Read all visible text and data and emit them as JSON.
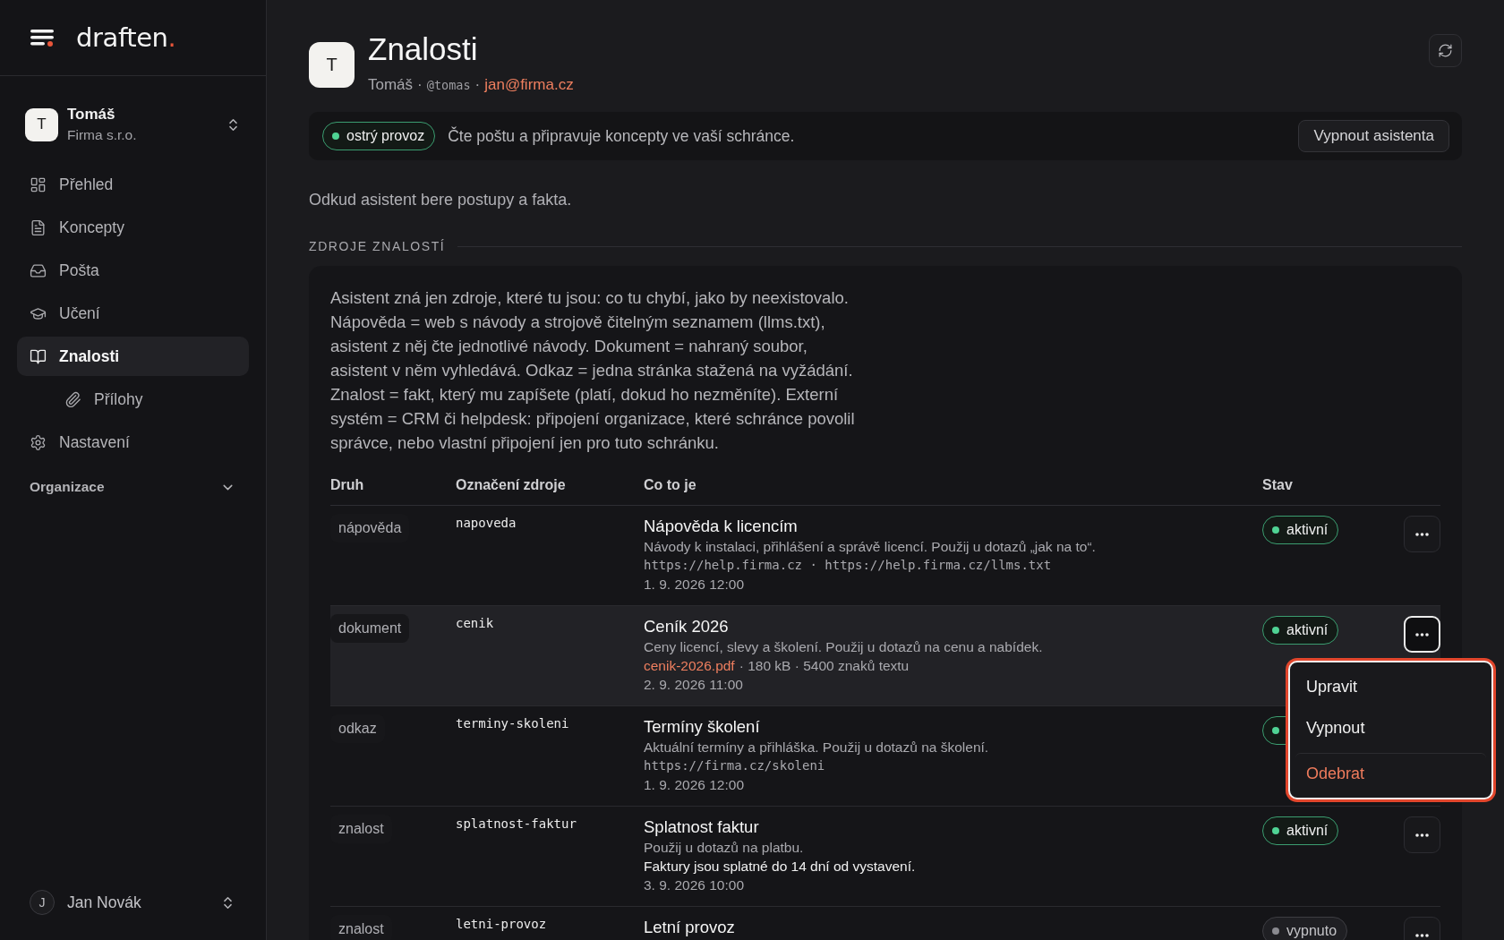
{
  "sidebar": {
    "logo": {
      "name": "draften",
      "dot": "."
    },
    "workspace": {
      "initial": "T",
      "name": "Tomáš",
      "org": "Firma s.r.o."
    },
    "nav": [
      {
        "label": "Přehled",
        "selected": false
      },
      {
        "label": "Koncepty",
        "selected": false
      },
      {
        "label": "Pošta",
        "selected": false
      },
      {
        "label": "Učení",
        "selected": false
      },
      {
        "label": "Znalosti",
        "selected": true,
        "children": [
          {
            "label": "Přílohy",
            "selected": false
          }
        ]
      },
      {
        "label": "Nastavení",
        "selected": false
      }
    ],
    "sections": [
      {
        "label": "Organizace",
        "expanded": false
      }
    ],
    "user": {
      "initial": "J",
      "name": "Jan Novák"
    }
  },
  "header": {
    "initial": "T",
    "title": "Znalosti",
    "owner": "Tomáš",
    "separator": "·",
    "handle": "@tomas",
    "email": "jan@firma.cz"
  },
  "status_bar": {
    "badge": {
      "label": "ostrý provoz",
      "live": true
    },
    "text": "Čte poštu a připravuje koncepty ve vaší schránce.",
    "button": "Vypnout asistenta"
  },
  "intro": "Odkud asistent bere postupy a fakta.",
  "sources": {
    "title": "ZDROJE ZNALOSTÍ",
    "description": "Asistent zná jen zdroje, které tu jsou: co tu chybí, jako by neexistovalo. Nápověda = web s návody a strojově čitelným seznamem (llms.txt), asistent z něj čte jednotlivé návody. Dokument = nahraný soubor, asistent v něm vyhledává. Odkaz = jedna stránka stažená na vyžádání. Znalost = fakt, který mu zapíšete (platí, dokud ho nezměníte). Externí systém = CRM či helpdesk: připojení organizace, které schránce povolil správce, nebo vlastní připojení jen pro tuto schránku.",
    "table": {
      "columns": [
        "Druh",
        "Označení zdroje",
        "Co to je",
        "Stav"
      ],
      "rows": [
        {
          "source_type": "nápověda",
          "id": "napoveda",
          "title": "Nápověda k licencím",
          "description": "Návody k instalaci, přihlášení a správě licencí. Použij u dotazů „jak na to“.",
          "url": "https://help.firma.cz · https://help.firma.cz/llms.txt",
          "date": "1. 9. 2026 12:00",
          "status": {
            "label": "aktivní",
            "active": true
          },
          "menu_expanded": false
        },
        {
          "source_type": "dokument",
          "id": "cenik",
          "title": "Ceník 2026",
          "description": "Ceny licencí, slevy a školení. Použij u dotazů na cenu a nabídek.",
          "file": {
            "name": "cenik-2026.pdf",
            "meta": "· 180 kB · 5400 znaků textu"
          },
          "date": "2. 9. 2026 11:00",
          "status": {
            "label": "aktivní",
            "active": true
          },
          "menu_expanded": true,
          "menu": [
            {
              "label": "Upravit",
              "kind": "normal"
            },
            {
              "label": "Vypnout",
              "kind": "normal"
            },
            {
              "label": "Odebrat",
              "kind": "danger"
            }
          ]
        },
        {
          "source_type": "odkaz",
          "id": "terminy-skoleni",
          "title": "Termíny školení",
          "description": "Aktuální termíny a přihláška. Použij u dotazů na školení.",
          "url": "https://firma.cz/skoleni",
          "date": "1. 9. 2026 12:00",
          "status": {
            "active": true
          },
          "menu_expanded": false
        },
        {
          "source_type": "znalost",
          "id": "splatnost-faktur",
          "title": "Splatnost faktur",
          "description": "Použij u dotazů na platbu.",
          "fact": "Faktury jsou splatné do 14 dní od vystavení.",
          "date": "3. 9. 2026 10:00",
          "status": {
            "label": "aktivní",
            "active": true
          },
          "menu_expanded": false
        },
        {
          "source_type": "znalost",
          "id": "letni-provoz",
          "title": "Letní provoz",
          "status": {
            "label": "vypnuto",
            "active": false
          },
          "menu_expanded": false
        }
      ]
    }
  }
}
